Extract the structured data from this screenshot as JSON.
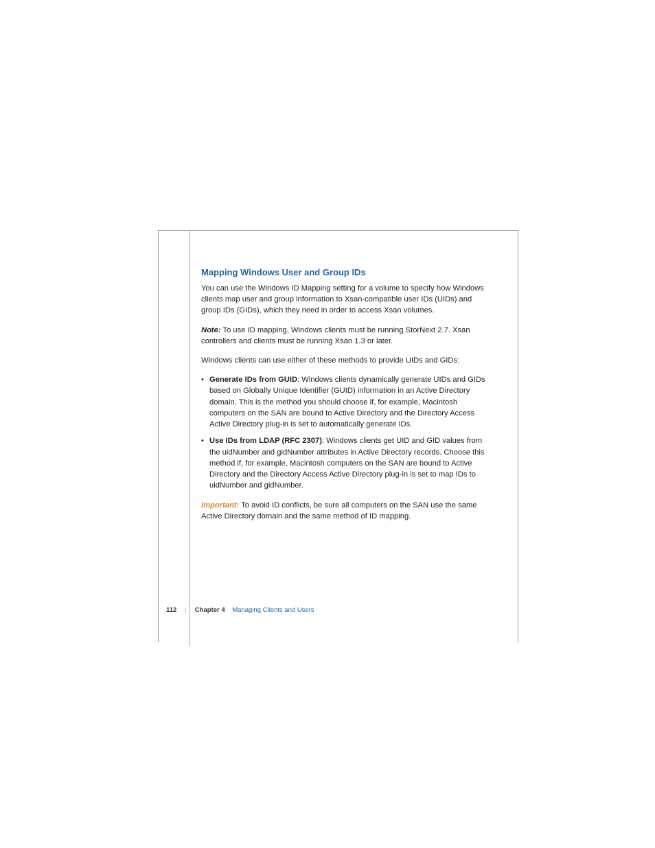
{
  "heading": "Mapping Windows User and Group IDs",
  "intro": "You can use the Windows ID Mapping setting for a volume to specify how Windows clients map user and group information to Xsan-compatible user IDs (UIDs) and group IDs (GIDs), which they need in order to access Xsan volumes.",
  "note_label": "Note:",
  "note_text": "  To use ID mapping, Windows clients must be running StorNext 2.7. Xsan controllers and clients must be running Xsan 1.3 or later.",
  "methods_intro": "Windows clients can use either of these methods to provide UIDs and GIDs:",
  "bullets": [
    {
      "bold": "Generate IDs from GUID",
      "rest": ":  Windows clients dynamically generate UIDs and GIDs based on Globally Unique Identifier (GUID) information in an Active Directory domain. This is the method you should choose if, for example, Macintosh computers on the SAN are bound to Active Directory and the Directory Access Active Directory plug-in is set to automatically generate IDs."
    },
    {
      "bold": " Use IDs from LDAP (RFC 2307)",
      "rest": ":  Windows clients get UID and GID values from the uidNumber and gidNumber attributes in Active Directory records. Choose this method if, for example, Macintosh computers on the SAN are bound to Active Directory and the Directory Access Active Directory plug-in is set to map IDs to uidNumber and gidNumber."
    }
  ],
  "important_label": "Important:",
  "important_text": "  To avoid ID conflicts, be sure all computers on the SAN use the same Active Directory domain and the same method of ID mapping.",
  "footer": {
    "page": "112",
    "chapter": "Chapter 4",
    "title": "Managing Clients and Users"
  }
}
